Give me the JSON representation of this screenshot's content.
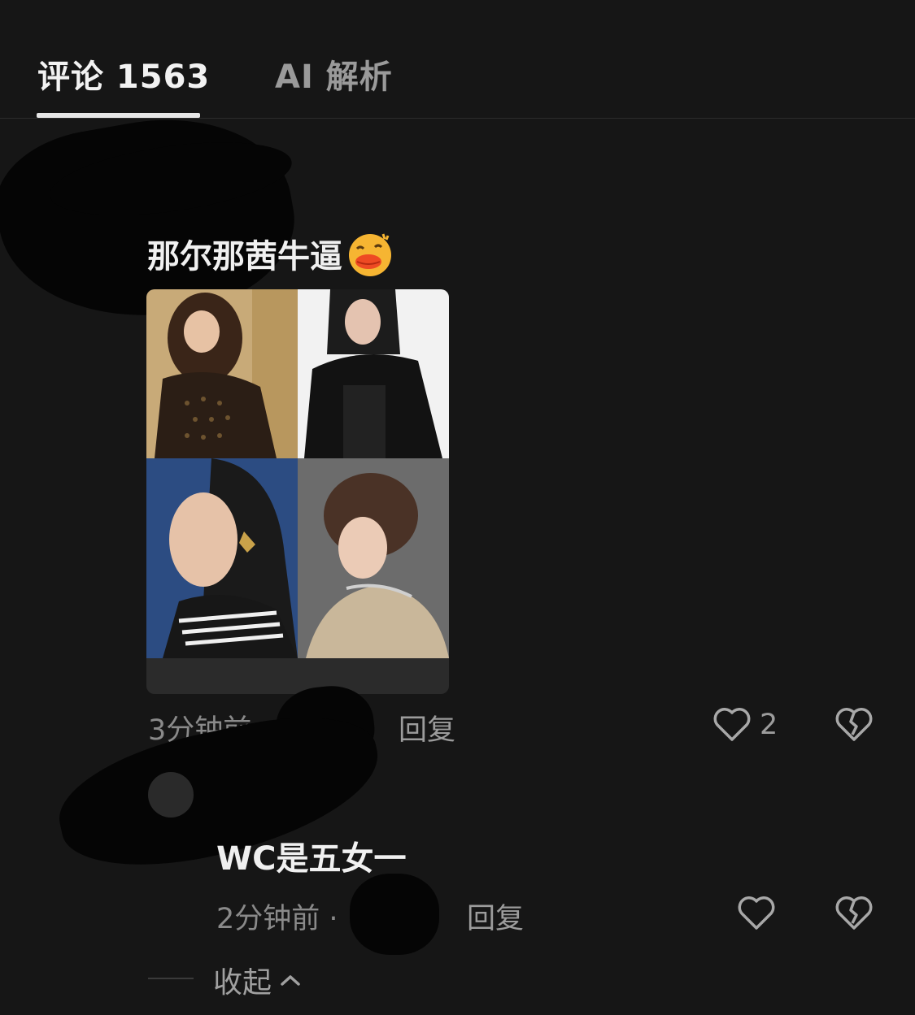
{
  "tabs": {
    "comments": "评论 1563",
    "ai": "AI 解析"
  },
  "comment": {
    "text": "那尔那茜牛逼",
    "emoji": "duck-lips-emoji",
    "time": "3分钟前 ·",
    "reply_label": "回复",
    "like_count": "2",
    "image_panels": [
      "woman-gold-dress-photo",
      "woman-black-blazer-photo",
      "woman-striped-jacket-photo",
      "woman-fur-coat-photo"
    ]
  },
  "reply": {
    "text": "WC是五女一",
    "time": "2分钟前 ·",
    "reply_label": "回复"
  },
  "collapse": {
    "label": "收起"
  },
  "colors": {
    "background": "#161616",
    "text_primary": "#f0f0f0",
    "text_secondary": "#8a8a8a"
  }
}
